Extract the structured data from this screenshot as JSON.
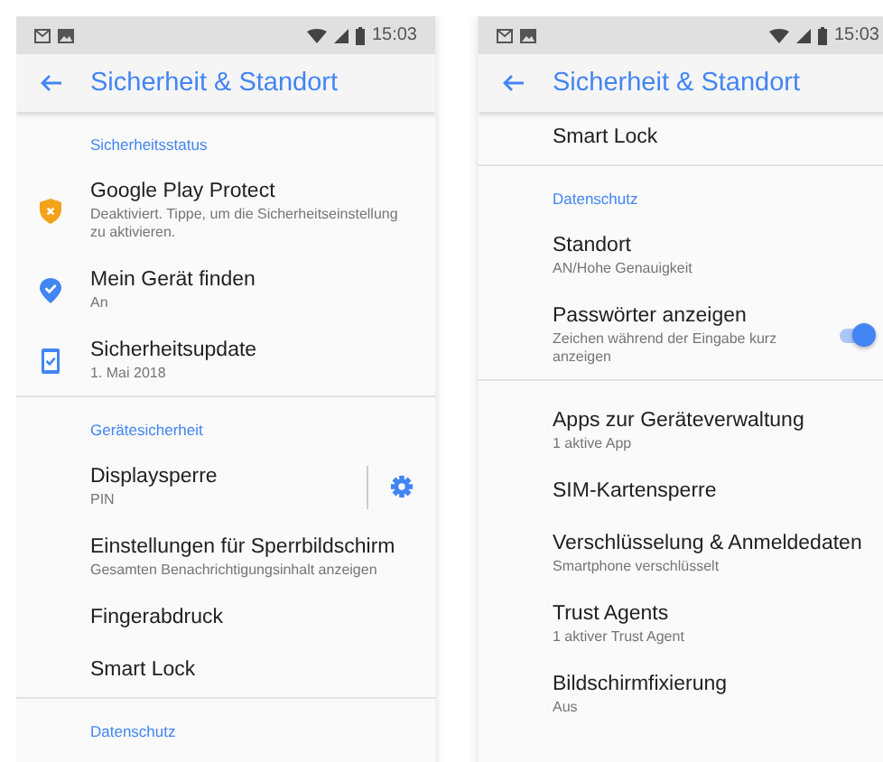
{
  "screens": [
    {
      "status_bar": {
        "time": "15:03"
      },
      "app_bar": {
        "title": "Sicherheit & Standort"
      },
      "sections": [
        {
          "header": "Sicherheitsstatus",
          "items": [
            {
              "title": "Google Play Protect",
              "subtitle": "Deaktiviert. Tippe, um die Sicherheitseinstellung zu aktivieren.",
              "kind": "shield"
            },
            {
              "title": "Mein Gerät finden",
              "subtitle": "An",
              "kind": "pin"
            },
            {
              "title": "Sicherheitsupdate",
              "subtitle": "1. Mai 2018",
              "kind": "phone"
            }
          ]
        },
        {
          "header": "Gerätesicherheit",
          "items": [
            {
              "title": "Displaysperre",
              "subtitle": "PIN",
              "settings_button": true
            },
            {
              "title": "Einstellungen für Sperrbildschirm",
              "subtitle": "Gesamten Benachrichtigungsinhalt anzeigen"
            },
            {
              "title": "Fingerabdruck"
            },
            {
              "title": "Smart Lock"
            }
          ]
        },
        {
          "header": "Datenschutz"
        }
      ]
    },
    {
      "status_bar": {
        "time": "15:03"
      },
      "app_bar": {
        "title": "Sicherheit & Standort"
      },
      "sections": [
        {
          "items": [
            {
              "title": "Smart Lock"
            }
          ]
        },
        {
          "header": "Datenschutz",
          "items": [
            {
              "title": "Standort",
              "subtitle": "AN/Hohe Genauigkeit"
            },
            {
              "title": "Passwörter anzeigen",
              "subtitle": "Zeichen während der Eingabe kurz anzeigen",
              "toggle": {
                "on": true
              }
            }
          ]
        },
        {
          "items": [
            {
              "title": "Apps zur Geräteverwaltung",
              "subtitle": "1 aktive App"
            },
            {
              "title": "SIM-Kartensperre"
            },
            {
              "title": "Verschlüsselung & Anmeldedaten",
              "subtitle": "Smartphone verschlüsselt"
            },
            {
              "title": "Trust Agents",
              "subtitle": "1 aktiver Trust Agent"
            },
            {
              "title": "Bildschirmfixierung",
              "subtitle": "Aus"
            }
          ]
        }
      ]
    }
  ]
}
